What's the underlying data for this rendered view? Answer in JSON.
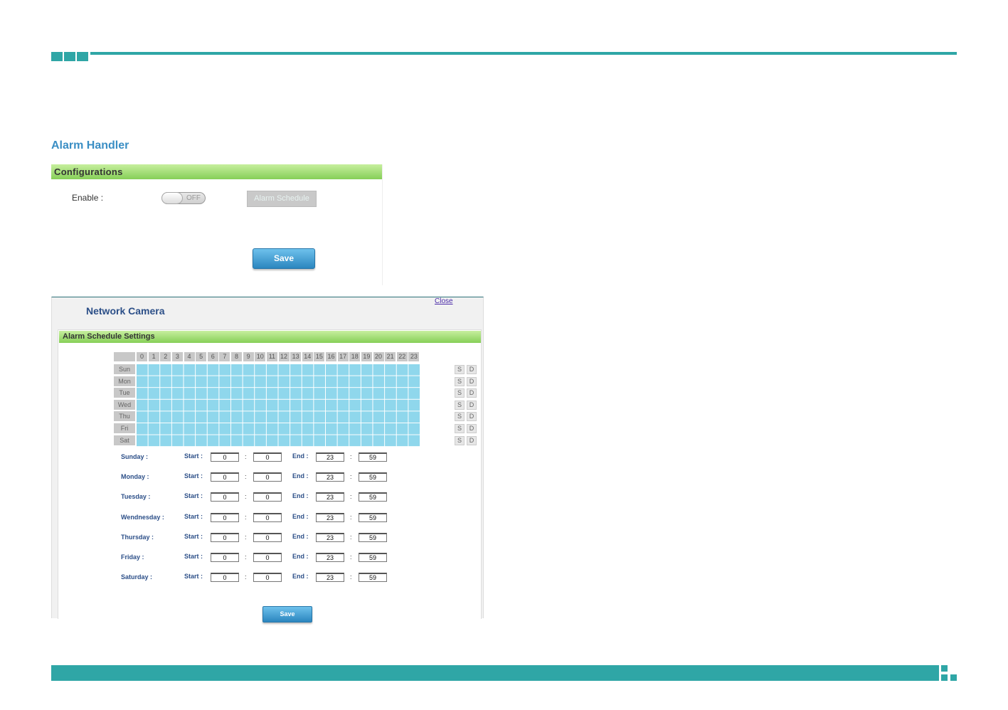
{
  "alarm_handler": {
    "title": "Alarm Handler",
    "section_title": "Configurations",
    "enable_label": "Enable :",
    "toggle_state": "OFF",
    "alarm_schedule_button": "Alarm Schedule",
    "save_label": "Save"
  },
  "popup": {
    "title": "Network Camera",
    "close_label": "Close",
    "section_title": "Alarm Schedule Settings",
    "hours": [
      "0",
      "1",
      "2",
      "3",
      "4",
      "5",
      "6",
      "7",
      "8",
      "9",
      "10",
      "11",
      "12",
      "13",
      "14",
      "15",
      "16",
      "17",
      "18",
      "19",
      "20",
      "21",
      "22",
      "23"
    ],
    "days": [
      "Sun",
      "Mon",
      "Tue",
      "Wed",
      "Thu",
      "Fri",
      "Sat"
    ],
    "s_label": "S",
    "d_label": "D",
    "grid_fill_color": "#8fd7ec",
    "start_label": "Start :",
    "end_label": "End :",
    "colon": ":",
    "rows": [
      {
        "day": "Sunday :",
        "start_h": "0",
        "start_m": "0",
        "end_h": "23",
        "end_m": "59"
      },
      {
        "day": "Monday :",
        "start_h": "0",
        "start_m": "0",
        "end_h": "23",
        "end_m": "59"
      },
      {
        "day": "Tuesday :",
        "start_h": "0",
        "start_m": "0",
        "end_h": "23",
        "end_m": "59"
      },
      {
        "day": "Wendnesday :",
        "start_h": "0",
        "start_m": "0",
        "end_h": "23",
        "end_m": "59"
      },
      {
        "day": "Thursday :",
        "start_h": "0",
        "start_m": "0",
        "end_h": "23",
        "end_m": "59"
      },
      {
        "day": "Friday :",
        "start_h": "0",
        "start_m": "0",
        "end_h": "23",
        "end_m": "59"
      },
      {
        "day": "Saturday :",
        "start_h": "0",
        "start_m": "0",
        "end_h": "23",
        "end_m": "59"
      }
    ],
    "save_label": "Save"
  }
}
